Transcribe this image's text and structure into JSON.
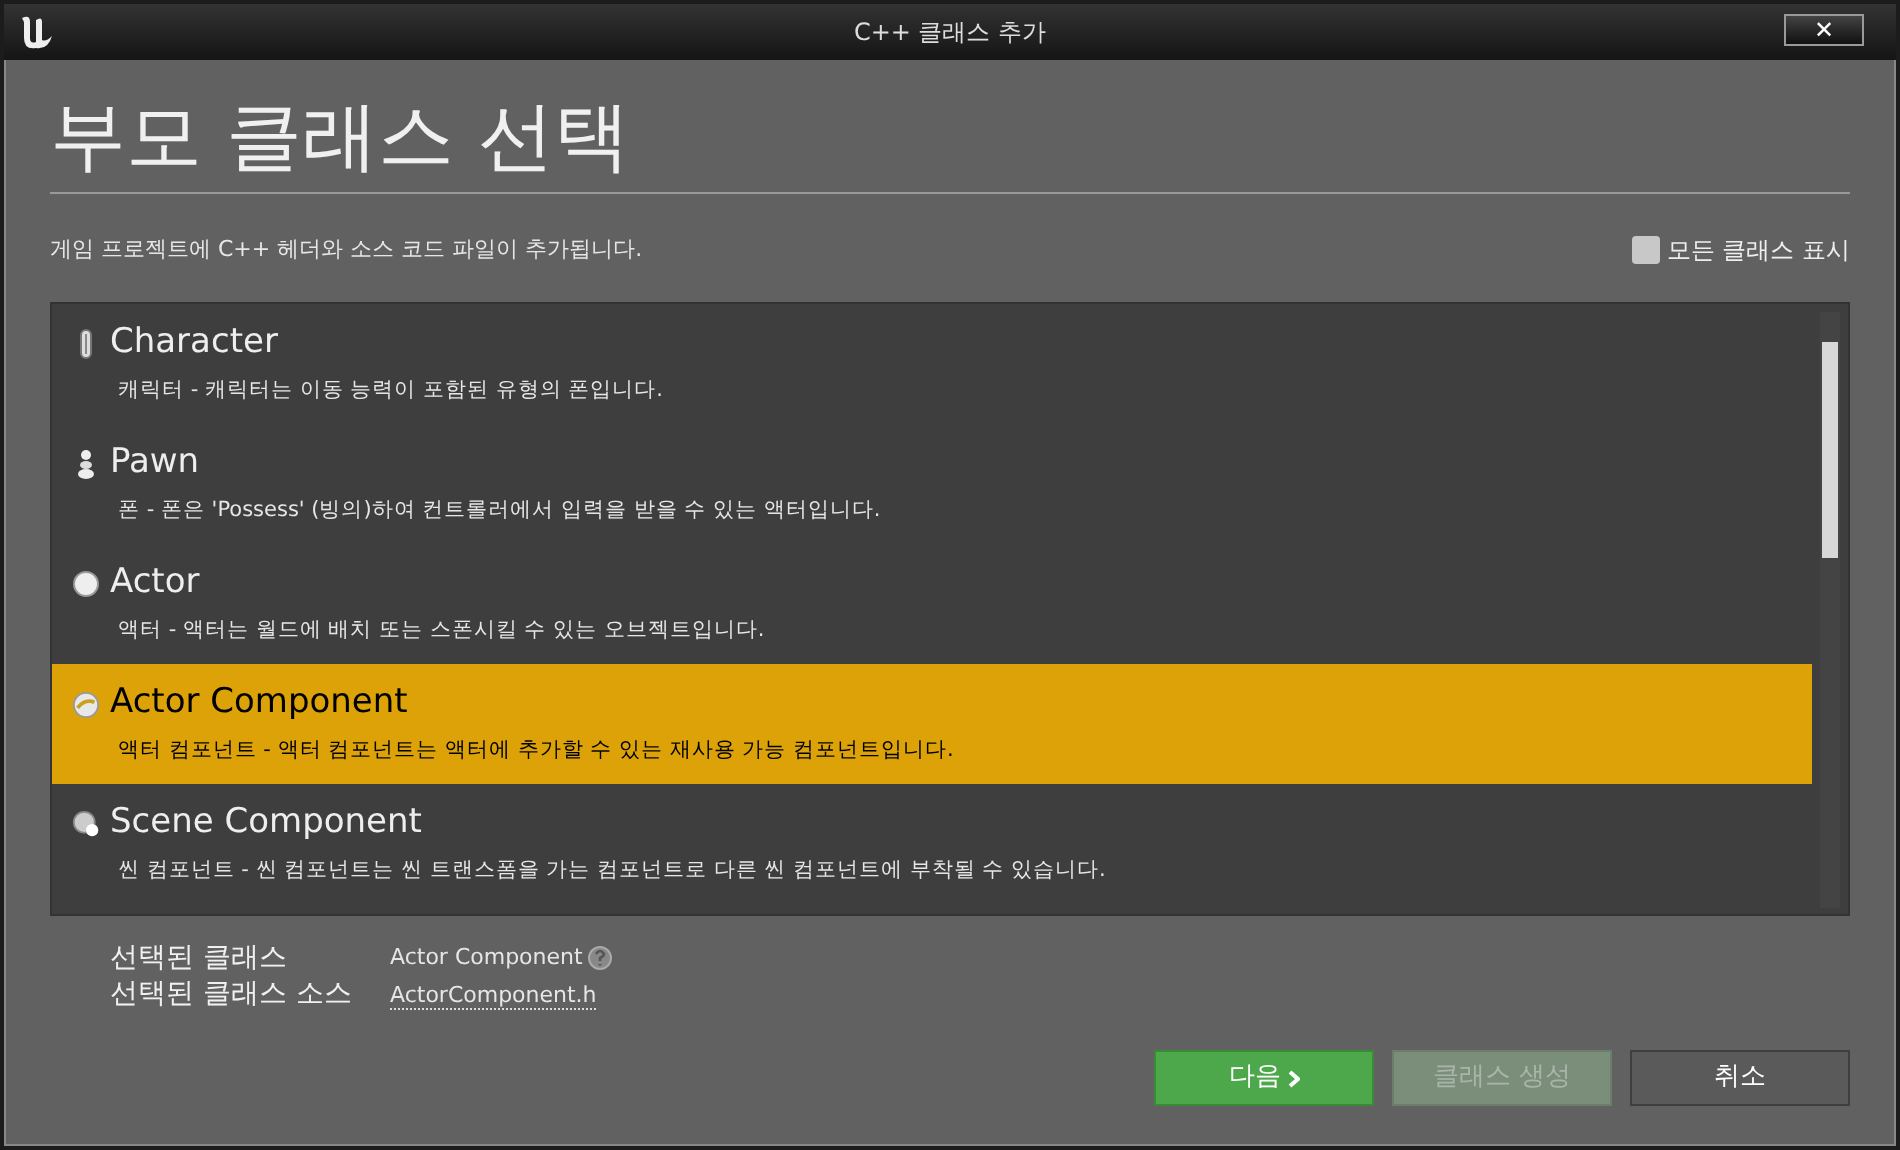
{
  "window": {
    "title": "C++ 클래스 추가",
    "close": "✕"
  },
  "heading": "부모 클래스 선택",
  "description": "게임 프로젝트에 C++ 헤더와 소스 코드 파일이 추가됩니다.",
  "show_all_classes": {
    "label": "모든 클래스 표시",
    "checked": false
  },
  "classes": [
    {
      "kind": "character",
      "name": "Character",
      "description": "캐릭터 - 캐릭터는 이동 능력이 포함된 유형의 폰입니다.",
      "selected": false
    },
    {
      "kind": "pawn",
      "name": "Pawn",
      "description": "폰 - 폰은 'Possess' (빙의)하여 컨트롤러에서 입력을 받을 수 있는 액터입니다.",
      "selected": false
    },
    {
      "kind": "actor",
      "name": "Actor",
      "description": "액터 - 액터는 월드에 배치 또는 스폰시킬 수 있는 오브젝트입니다.",
      "selected": false
    },
    {
      "kind": "actor-component",
      "name": "Actor Component",
      "description": "액터 컴포넌트 - 액터 컴포넌트는 액터에 추가할 수 있는 재사용 가능 컴포넌트입니다.",
      "selected": true
    },
    {
      "kind": "scene-component",
      "name": "Scene Component",
      "description": "씬 컴포넌트 - 씬 컴포넌트는 씬 트랜스폼을 가는 컴포넌트로 다른 씬 컴포넌트에 부착될 수 있습니다.",
      "selected": false
    }
  ],
  "selected_class": {
    "label": "선택된 클래스",
    "value": "Actor Component"
  },
  "selected_source": {
    "label": "선택된 클래스 소스",
    "value": "ActorComponent.h"
  },
  "buttons": [
    {
      "kind": "next",
      "label": "다음",
      "disabled": false
    },
    {
      "kind": "create",
      "label": "클래스 생성",
      "disabled": true
    },
    {
      "kind": "cancel",
      "label": "취소",
      "disabled": false
    }
  ]
}
